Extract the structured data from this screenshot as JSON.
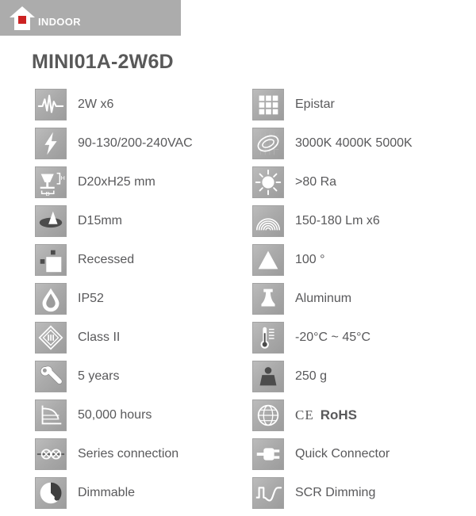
{
  "header": {
    "banner_label": "INDOOR",
    "logo_icon": "house-icon",
    "logo_accent_color": "#cc2222",
    "banner_color": "#acacac"
  },
  "product": {
    "title": "MINI01A-2W6D",
    "title_color": "#595959"
  },
  "specs": {
    "left": [
      {
        "icon": "waveform-power-icon",
        "label": "2W x6"
      },
      {
        "icon": "lightning-bolt-icon",
        "label": "90-130/200-240VAC"
      },
      {
        "icon": "fixture-dimensions-icon",
        "label": "D20xH25 mm"
      },
      {
        "icon": "cutout-diameter-icon",
        "label": "D15mm"
      },
      {
        "icon": "recessed-mount-icon",
        "label": "Recessed"
      },
      {
        "icon": "water-drop-ip-rating-icon",
        "label": "IP52"
      },
      {
        "icon": "class-two-insulation-icon",
        "label": "Class II"
      },
      {
        "icon": "wrench-warranty-icon",
        "label": "5 years"
      },
      {
        "icon": "lifetime-graph-icon",
        "label": "50,000 hours"
      },
      {
        "icon": "series-connection-icon",
        "label": "Series connection"
      },
      {
        "icon": "dimmer-knob-icon",
        "label": "Dimmable"
      }
    ],
    "right": [
      {
        "icon": "led-chip-grid-icon",
        "label": "Epistar"
      },
      {
        "icon": "color-temperature-icon",
        "label": "3000K 4000K 5000K"
      },
      {
        "icon": "sun-cri-icon",
        "label": ">80 Ra"
      },
      {
        "icon": "luminous-flux-icon",
        "label": "150-180 Lm x6"
      },
      {
        "icon": "beam-angle-icon",
        "label": "100 °"
      },
      {
        "icon": "housing-material-icon",
        "label": "Aluminum"
      },
      {
        "icon": "thermometer-icon",
        "label": "-20°C ~ 45°C"
      },
      {
        "icon": "weight-icon",
        "label": "250 g"
      },
      {
        "icon": "globe-certification-icon",
        "label": "CE RoHS",
        "ce": "CE",
        "rohs": "RoHS"
      },
      {
        "icon": "plug-connector-icon",
        "label": "Quick Connector"
      },
      {
        "icon": "scr-waveform-icon",
        "label": "SCR Dimming"
      }
    ]
  }
}
